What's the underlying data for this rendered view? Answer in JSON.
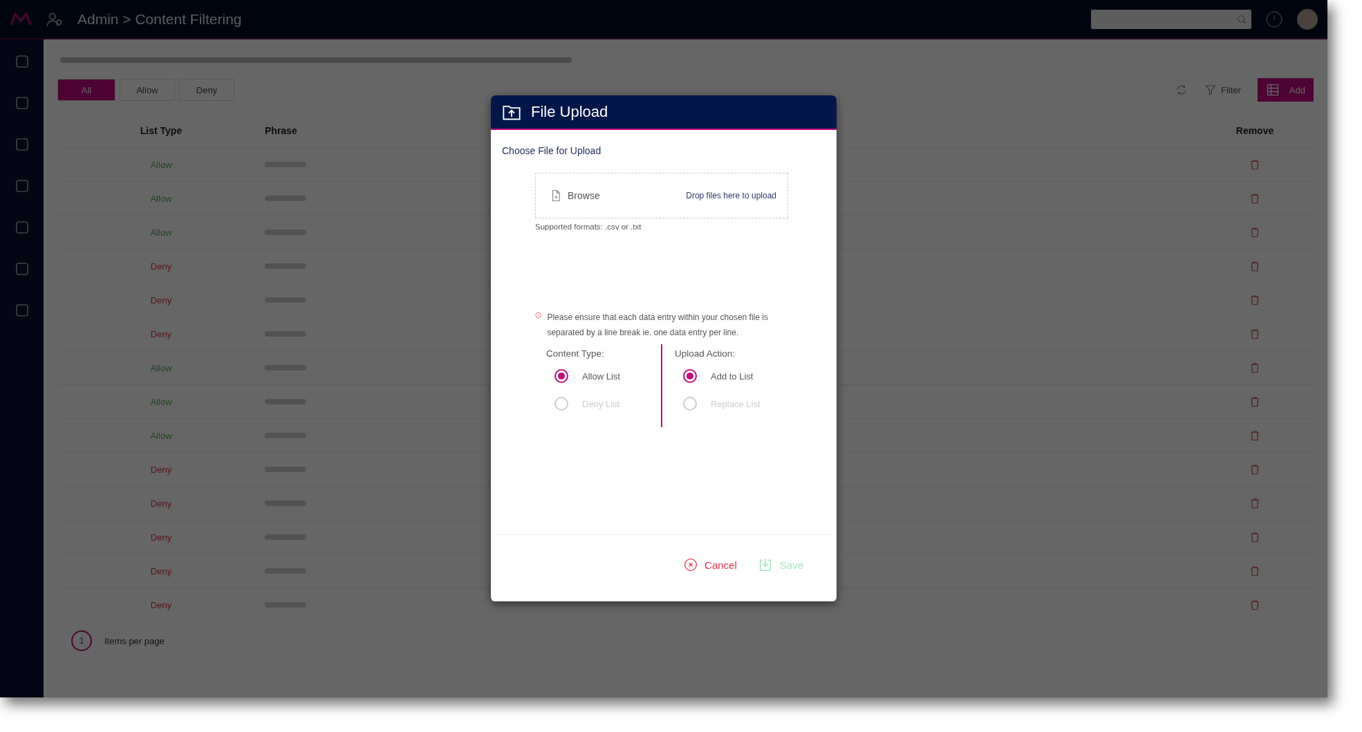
{
  "app_bar": {
    "breadcrumb": "Admin > Content Filtering"
  },
  "toolbar": {
    "tabs": [
      {
        "label": "All",
        "selected": true
      },
      {
        "label": "Allow",
        "selected": false
      },
      {
        "label": "Deny",
        "selected": false
      }
    ],
    "filter_label": "Filter",
    "add_label": "Add"
  },
  "table": {
    "columns": [
      "List Type",
      "Phrase",
      "Remove"
    ],
    "rows": [
      {
        "list_type": "Allow",
        "kind": "allow"
      },
      {
        "list_type": "Allow",
        "kind": "allow"
      },
      {
        "list_type": "Allow",
        "kind": "allow"
      },
      {
        "list_type": "Deny",
        "kind": "deny"
      },
      {
        "list_type": "Deny",
        "kind": "deny"
      },
      {
        "list_type": "Deny",
        "kind": "deny"
      },
      {
        "list_type": "Allow",
        "kind": "allow"
      },
      {
        "list_type": "Allow",
        "kind": "allow"
      },
      {
        "list_type": "Allow",
        "kind": "allow"
      },
      {
        "list_type": "Deny",
        "kind": "deny"
      },
      {
        "list_type": "Deny",
        "kind": "deny"
      },
      {
        "list_type": "Deny",
        "kind": "deny"
      },
      {
        "list_type": "Deny",
        "kind": "deny"
      },
      {
        "list_type": "Deny",
        "kind": "deny"
      }
    ]
  },
  "pagination": {
    "current_page": "1",
    "items_per_page_label": "Items per page"
  },
  "dialog": {
    "title": "File Upload",
    "section_label": "Choose File for Upload",
    "browse_label": "Browse",
    "drop_hint": "Drop files here to upload",
    "formats_note": "Supported formats: .csv or .txt",
    "warning": "Please ensure that each data entry within your chosen file is separated by a line break ie. one data entry per line.",
    "groups": [
      {
        "label": "Content Type:",
        "options": [
          {
            "label": "Allow List",
            "selected": true
          },
          {
            "label": "Deny List",
            "selected": false
          }
        ]
      },
      {
        "label": "Upload Action:",
        "options": [
          {
            "label": "Add to List",
            "selected": true
          },
          {
            "label": "Replace List",
            "selected": false
          }
        ]
      }
    ],
    "cancel": {
      "label": "Cancel",
      "disabled": false
    },
    "save": {
      "label": "Save",
      "disabled": true
    }
  }
}
